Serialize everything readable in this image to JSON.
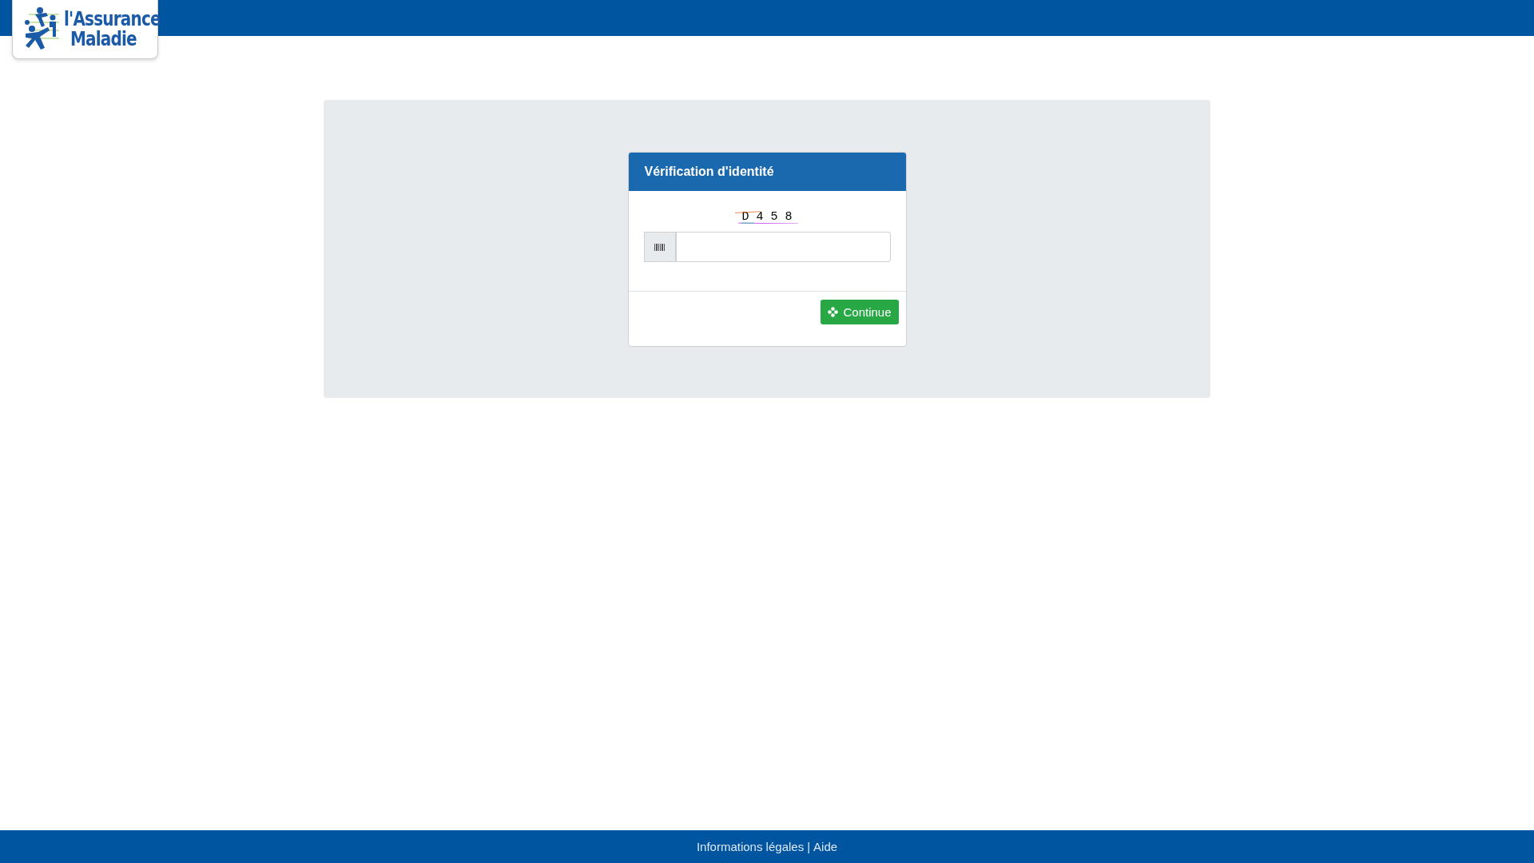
{
  "logo": {
    "line_1": "l'Assurance",
    "line_2": "Maladie"
  },
  "card": {
    "title": "Vérification d'identité",
    "captcha": "D 4 5 8",
    "button": "Continue"
  },
  "footer": {
    "links": [
      "Informations légales",
      "Aide"
    ],
    "separator": "|"
  }
}
